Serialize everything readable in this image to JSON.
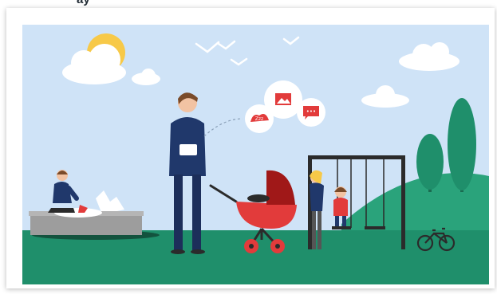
{
  "illustration": {
    "title_fragment": "ay",
    "bubbles": [
      {
        "icon": "sleep-zzz-icon",
        "text": "Zzz"
      },
      {
        "icon": "image-icon",
        "text": ""
      },
      {
        "icon": "chat-icon",
        "text": "•••"
      }
    ],
    "colors": {
      "sky": "#cfe3f7",
      "grass": "#1f8f6b",
      "hill": "#2aa37b",
      "accent_red": "#e23b3b",
      "navy": "#20386b",
      "sun": "#f7c948"
    }
  }
}
